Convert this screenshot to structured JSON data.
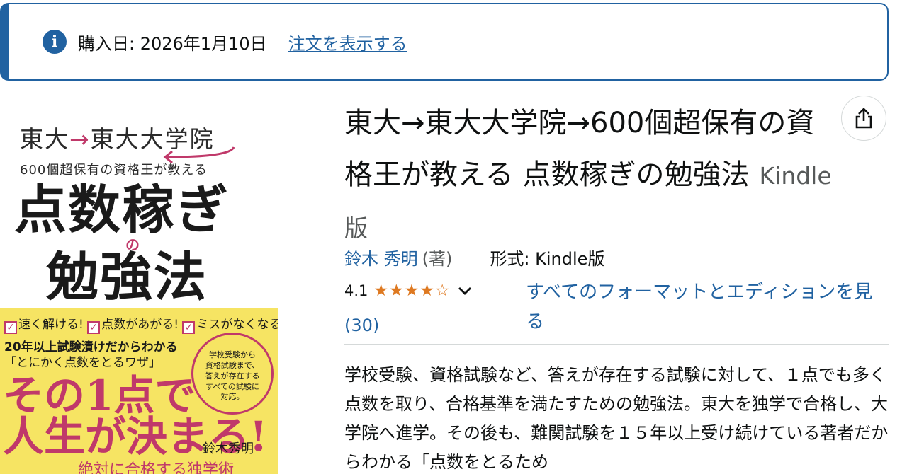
{
  "banner": {
    "icon": "info-icon",
    "purchase_date_text": "購入日: 2026年1月10日",
    "view_order_link": "注文を表示する"
  },
  "cover": {
    "top_line_a": "東大",
    "top_line_arrow": "→",
    "top_line_b": "東大大学院",
    "subtitle": "600個超保有の資格王が教える",
    "title_line1": "点数稼ぎ",
    "title_no": "の",
    "title_line2": "勉強法",
    "checks": [
      "速く解ける!",
      "点数があがる!",
      "ミスがなくなる!"
    ],
    "line1": "20年以上試験漬けだからわかる",
    "line2": "「とにかく点数をとるワザ」",
    "circle_text": [
      "学校受験から",
      "資格試験まで、",
      "答えが存在する",
      "すべての試験に",
      "対応。"
    ],
    "big_line1": "その1点で",
    "big_line2": "人生が決まる!",
    "author": "鈴木秀明",
    "bottom_line": "絶対に合格する独学術"
  },
  "product": {
    "title": "東大→東大大学院→600個超保有の資格王が教える 点数稼ぎの勉強法",
    "edition": "Kindle版",
    "author_name": "鈴木 秀明",
    "author_role": "(著)",
    "format_text": "形式: Kindle版",
    "rating_value": "4.1",
    "rating_stars": 4.1,
    "stars_display": "★★★★☆",
    "review_count": "(30)",
    "all_formats_link": "すべてのフォーマットとエディションを見る",
    "description": "学校受験、資格試験など、答えが存在する試験に対して、１点でも多く点数を取り、合格基準を満たすための勉強法。東大を独学で合格し、大学院へ進学。その後も、難関試験を１５年以上受け続けている著者だからわかる「点数をとるため"
  },
  "colors": {
    "accent": "#2162a1",
    "star": "#de7921",
    "cover_accent": "#c0396a",
    "cover_yellow": "#f6e463"
  }
}
